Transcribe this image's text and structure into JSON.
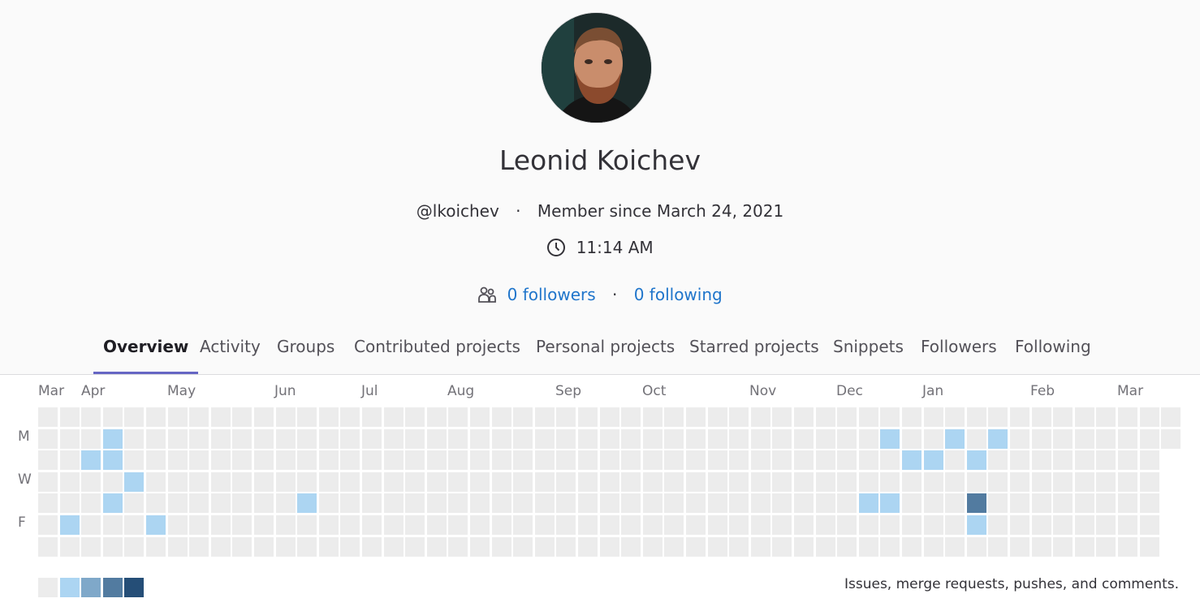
{
  "profile": {
    "name": "Leonid Koichev",
    "username": "@lkoichev",
    "member_since": "Member since March 24, 2021",
    "local_time": "11:14 AM",
    "followers": "0 followers",
    "following": "0 following"
  },
  "tabs": [
    {
      "label": "Overview",
      "active": true
    },
    {
      "label": "Activity"
    },
    {
      "label": "Groups"
    },
    {
      "label": "Contributed projects"
    },
    {
      "label": "Personal projects"
    },
    {
      "label": "Starred projects"
    },
    {
      "label": "Snippets"
    },
    {
      "label": "Followers"
    },
    {
      "label": "Following"
    }
  ],
  "calendar": {
    "months": [
      "Mar",
      "Apr",
      "May",
      "Jun",
      "Jul",
      "Aug",
      "Sep",
      "Oct",
      "Nov",
      "Dec",
      "Jan",
      "Feb",
      "Mar"
    ],
    "days": [
      "M",
      "W",
      "F"
    ],
    "level_colors": [
      "#ececec",
      "#acd5f2",
      "#7fa8c9",
      "#527ba0",
      "#254e77"
    ],
    "active_days": [
      {
        "week": 3,
        "day": 1,
        "level": 1
      },
      {
        "week": 2,
        "day": 2,
        "level": 1
      },
      {
        "week": 3,
        "day": 2,
        "level": 1
      },
      {
        "week": 4,
        "day": 3,
        "level": 1
      },
      {
        "week": 3,
        "day": 4,
        "level": 1
      },
      {
        "week": 1,
        "day": 5,
        "level": 1
      },
      {
        "week": 5,
        "day": 5,
        "level": 1
      },
      {
        "week": 12,
        "day": 4,
        "level": 1
      },
      {
        "week": 39,
        "day": 1,
        "level": 1
      },
      {
        "week": 38,
        "day": 4,
        "level": 1
      },
      {
        "week": 39,
        "day": 4,
        "level": 1
      },
      {
        "week": 40,
        "day": 2,
        "level": 1
      },
      {
        "week": 41,
        "day": 2,
        "level": 1
      },
      {
        "week": 42,
        "day": 1,
        "level": 1
      },
      {
        "week": 43,
        "day": 2,
        "level": 1
      },
      {
        "week": 43,
        "day": 4,
        "level": 3
      },
      {
        "week": 43,
        "day": 5,
        "level": 1
      },
      {
        "week": 44,
        "day": 1,
        "level": 1
      }
    ],
    "legend_text": "Issues, merge requests, pushes, and comments."
  }
}
